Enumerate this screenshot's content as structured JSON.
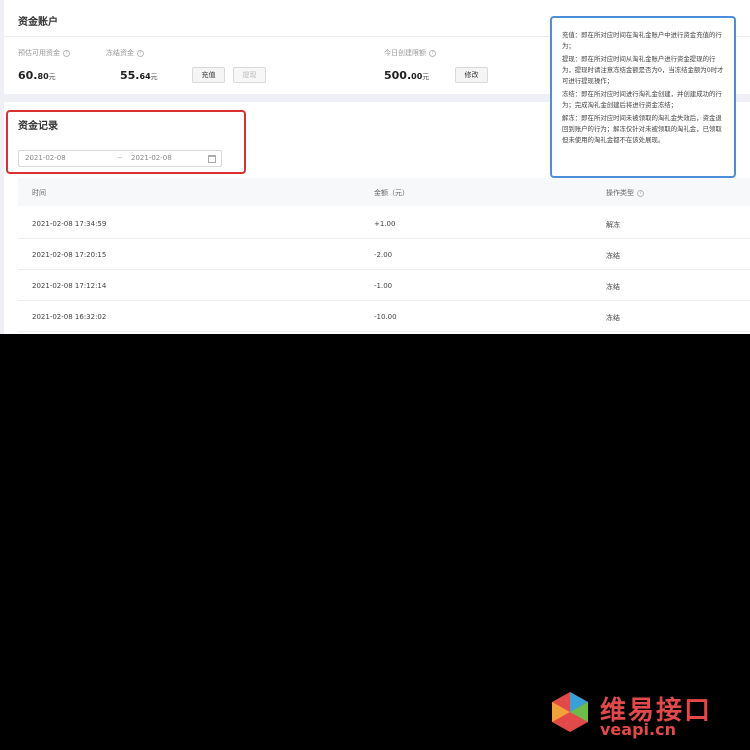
{
  "account": {
    "title": "资金账户",
    "available": {
      "label": "预估可用资金",
      "int": "60.",
      "dec": "80",
      "unit": "元"
    },
    "frozen": {
      "label": "冻结资金",
      "int": "55.",
      "dec": "64",
      "unit": "元"
    },
    "recharge_label": "充值",
    "withdraw_label": "提现",
    "limit": {
      "label": "今日创建限额",
      "int": "500.",
      "dec": "00",
      "unit": "元"
    },
    "modify_label": "修改"
  },
  "tooltip": {
    "lines": [
      "充值：即在所对应时间在淘礼金账户中进行资金充值的行为；",
      "提现：即在所对应时间从淘礼金账户进行资金提现的行为，提现时请注意冻结金额是否为0，当冻结金额为0时才可进行提现操作；",
      "冻结：即在所对应时间进行淘礼金创建，并创建成功的行为；完成淘礼金创建后将进行资金冻结；",
      "解冻：即在所对应时间未被领取的淘礼金失效后，资金退回到账户的行为；解冻仅针对未被领取的淘礼金，已领取但未使用的淘礼金都不在该处展现。"
    ]
  },
  "records": {
    "title": "资金记录",
    "date_start": "2021-02-08",
    "date_end": "2021-02-08",
    "columns": [
      "时间",
      "金额（元）",
      "操作类型"
    ],
    "rows": [
      {
        "time": "2021-02-08 17:34:59",
        "amount": "+1.00",
        "type": "解冻"
      },
      {
        "time": "2021-02-08 17:20:15",
        "amount": "-2.00",
        "type": "冻结"
      },
      {
        "time": "2021-02-08 17:12:14",
        "amount": "-1.00",
        "type": "冻结"
      },
      {
        "time": "2021-02-08 16:32:02",
        "amount": "-10.00",
        "type": "冻结"
      }
    ]
  },
  "watermark": {
    "brand": "维易接口",
    "url": "veapi.cn"
  },
  "colors": {
    "highlight_red": "#d9312f",
    "highlight_blue": "#4a8fd8",
    "brand": "#e24a4a"
  }
}
